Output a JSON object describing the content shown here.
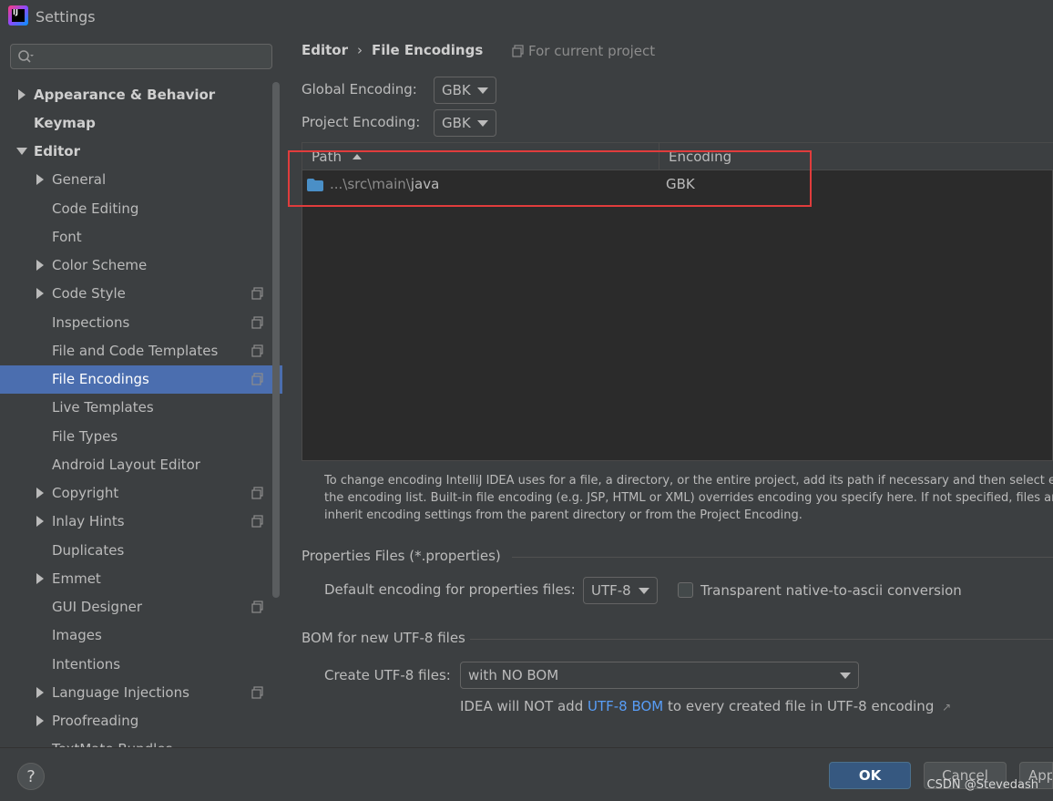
{
  "window": {
    "title": "Settings",
    "logo_text": "IJ"
  },
  "search": {
    "placeholder": ""
  },
  "sidebar": {
    "items": [
      {
        "label": "Appearance & Behavior",
        "level": 0,
        "arrow": "right",
        "bold": true
      },
      {
        "label": "Keymap",
        "level": 0,
        "arrow": "none",
        "bold": true
      },
      {
        "label": "Editor",
        "level": 0,
        "arrow": "down",
        "bold": true
      },
      {
        "label": "General",
        "level": 1,
        "arrow": "right"
      },
      {
        "label": "Code Editing",
        "level": 1,
        "arrow": "none"
      },
      {
        "label": "Font",
        "level": 1,
        "arrow": "none"
      },
      {
        "label": "Color Scheme",
        "level": 1,
        "arrow": "right"
      },
      {
        "label": "Code Style",
        "level": 1,
        "arrow": "right",
        "project_icon": true
      },
      {
        "label": "Inspections",
        "level": 1,
        "arrow": "none",
        "project_icon": true
      },
      {
        "label": "File and Code Templates",
        "level": 1,
        "arrow": "none",
        "project_icon": true
      },
      {
        "label": "File Encodings",
        "level": 1,
        "arrow": "none",
        "project_icon": true,
        "selected": true
      },
      {
        "label": "Live Templates",
        "level": 1,
        "arrow": "none"
      },
      {
        "label": "File Types",
        "level": 1,
        "arrow": "none"
      },
      {
        "label": "Android Layout Editor",
        "level": 1,
        "arrow": "none"
      },
      {
        "label": "Copyright",
        "level": 1,
        "arrow": "right",
        "project_icon": true
      },
      {
        "label": "Inlay Hints",
        "level": 1,
        "arrow": "right",
        "project_icon": true
      },
      {
        "label": "Duplicates",
        "level": 1,
        "arrow": "none"
      },
      {
        "label": "Emmet",
        "level": 1,
        "arrow": "right"
      },
      {
        "label": "GUI Designer",
        "level": 1,
        "arrow": "none",
        "project_icon": true
      },
      {
        "label": "Images",
        "level": 1,
        "arrow": "none"
      },
      {
        "label": "Intentions",
        "level": 1,
        "arrow": "none"
      },
      {
        "label": "Language Injections",
        "level": 1,
        "arrow": "right",
        "project_icon": true
      },
      {
        "label": "Proofreading",
        "level": 1,
        "arrow": "right"
      },
      {
        "label": "TextMate Bundles",
        "level": 1,
        "arrow": "none"
      }
    ]
  },
  "breadcrumb": {
    "parent": "Editor",
    "separator": "›",
    "current": "File Encodings"
  },
  "scope_note": "For current project",
  "global_encoding": {
    "label": "Global Encoding:",
    "value": "GBK"
  },
  "project_encoding": {
    "label": "Project Encoding:",
    "value": "GBK"
  },
  "table": {
    "columns": [
      "Path",
      "Encoding"
    ],
    "rows": [
      {
        "path_prefix": "...\\src\\main\\",
        "path_name": "java",
        "encoding": "GBK"
      }
    ]
  },
  "help_lines": [
    "To change encoding IntelliJ IDEA uses for a file, a directory, or the entire project, add its path if necessary and then select encoding from",
    "the encoding list. Built-in file encoding (e.g. JSP, HTML or XML) overrides encoding you specify here. If not specified, files and directories",
    "inherit encoding settings from the parent directory or from the Project Encoding."
  ],
  "properties_section": {
    "title": "Properties Files (*.properties)",
    "default_label": "Default encoding for properties files:",
    "default_value": "UTF-8",
    "transparent_label": "Transparent native-to-ascii conversion",
    "transparent_checked": false
  },
  "bom_section": {
    "title": "BOM for new UTF-8 files",
    "create_label": "Create UTF-8 files:",
    "create_value": "with NO BOM",
    "note_prefix": "IDEA will NOT add ",
    "note_link": "UTF-8 BOM",
    "note_suffix": " to every created file in UTF-8 encoding",
    "note_arrow": "↗"
  },
  "buttons": {
    "help": "?",
    "ok": "OK",
    "cancel": "Cancel",
    "apply": "Apply"
  },
  "watermark": "CSDN @Stevedash",
  "colors": {
    "selection": "#4b6eaf",
    "accent_link": "#589df6",
    "highlight_box": "#e03c3c",
    "folder": "#4a8fc7"
  }
}
